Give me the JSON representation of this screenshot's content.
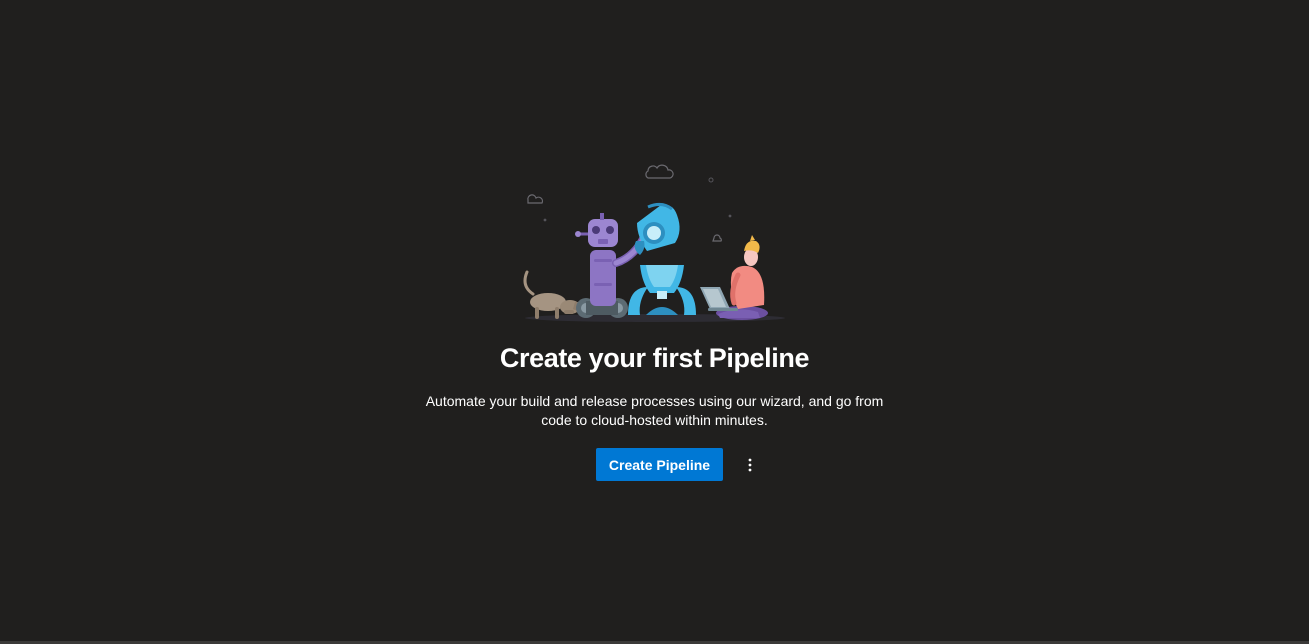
{
  "empty_state": {
    "illustration_icon": "pipeline-robot-rocket-illustration",
    "title": "Create your first Pipeline",
    "description": "Automate your build and release processes using our wizard, and go from code to cloud-hosted within minutes.",
    "primary_button_label": "Create Pipeline",
    "more_actions_icon": "more-vertical-icon"
  },
  "colors": {
    "background": "#201f1e",
    "primary_button": "#0078d4",
    "text": "#ffffff"
  }
}
